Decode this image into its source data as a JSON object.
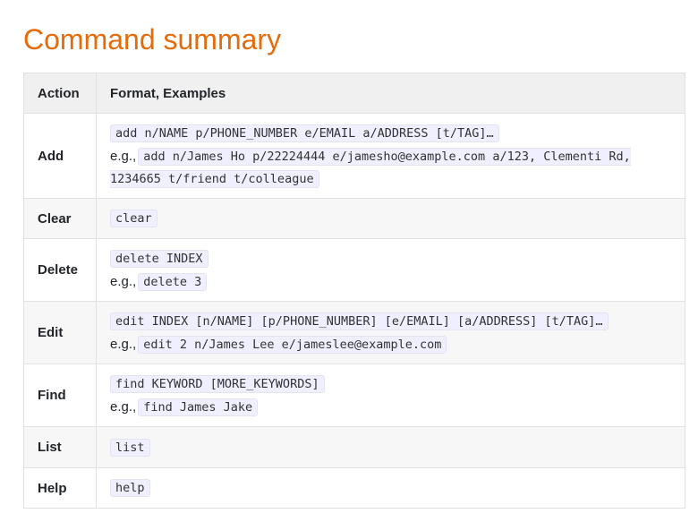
{
  "title": "Command summary",
  "table": {
    "headers": {
      "action": "Action",
      "format": "Format, Examples"
    },
    "eg_label": "e.g.,",
    "rows": [
      {
        "action": "Add",
        "format": "add n/NAME p/PHONE_NUMBER e/EMAIL a/ADDRESS [t/TAG]…",
        "example": "add n/James Ho p/22224444 e/jamesho@example.com a/123, Clementi Rd, 1234665 t/friend t/colleague"
      },
      {
        "action": "Clear",
        "format": "clear",
        "example": ""
      },
      {
        "action": "Delete",
        "format": "delete INDEX",
        "example": "delete 3"
      },
      {
        "action": "Edit",
        "format": "edit INDEX [n/NAME] [p/PHONE_NUMBER] [e/EMAIL] [a/ADDRESS] [t/TAG]…",
        "example": "edit 2 n/James Lee e/jameslee@example.com"
      },
      {
        "action": "Find",
        "format": "find KEYWORD [MORE_KEYWORDS]",
        "example": "find James Jake"
      },
      {
        "action": "List",
        "format": "list",
        "example": ""
      },
      {
        "action": "Help",
        "format": "help",
        "example": ""
      }
    ]
  }
}
